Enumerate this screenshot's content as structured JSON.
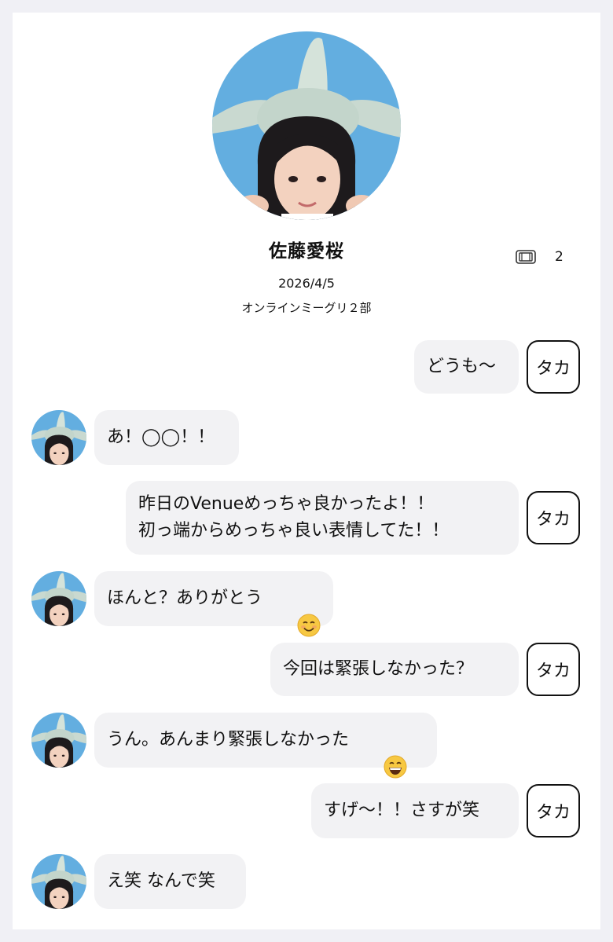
{
  "profile": {
    "name": "佐藤愛桜",
    "ticket_count": "2",
    "date": "2026/4/5",
    "event": "オンラインミーグリ２部"
  },
  "self_tag": "タカ",
  "colors": {
    "bubble": "#f2f2f4",
    "sky": "#63aee0",
    "hat": "#c9d9d0"
  },
  "messages": [
    {
      "sender": "me",
      "text": "どうも〜"
    },
    {
      "sender": "idol",
      "text": "あ！◯◯！！"
    },
    {
      "sender": "me",
      "text": "昨日のVenueめっちゃ良かったよ！！\n初っ端からめっちゃ良い表情してた！！"
    },
    {
      "sender": "idol",
      "text": "ほんと？ありがとう",
      "emoji": "smiling-face-icon"
    },
    {
      "sender": "me",
      "text": "今回は緊張しなかった？"
    },
    {
      "sender": "idol",
      "text": "うん。あんまり緊張しなかった",
      "emoji": "grinning-face-icon"
    },
    {
      "sender": "me",
      "text": "すげ〜！！さすが笑"
    },
    {
      "sender": "idol",
      "text": "え笑 なんで笑"
    }
  ]
}
